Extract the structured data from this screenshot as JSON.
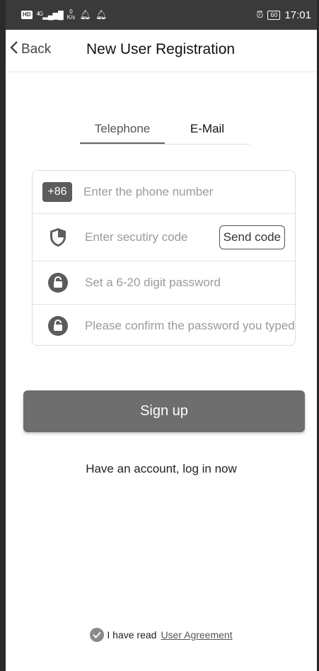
{
  "status_bar": {
    "hd_badge": "HD",
    "network": "4G",
    "speed_value": "0",
    "speed_unit": "K/s",
    "battery": "60",
    "time": "17:01"
  },
  "header": {
    "back_label": "Back",
    "title": "New User Registration"
  },
  "tabs": [
    {
      "label": "Telephone",
      "active": true
    },
    {
      "label": "E-Mail",
      "active": false
    }
  ],
  "form": {
    "country_code": "+86",
    "phone_placeholder": "Enter the phone number",
    "security_placeholder": "Enter secutiry code",
    "send_code_label": "Send code",
    "password_placeholder": "Set a 6-20 digit password",
    "confirm_placeholder": "Please confirm the password you typed"
  },
  "actions": {
    "signup_label": "Sign up",
    "login_link": "Have an account, log in now"
  },
  "agreement": {
    "prefix": "I have read",
    "link_label": "User Agreement"
  },
  "colors": {
    "status_bar_bg": "#3a3a3a",
    "button_bg": "#6e6e6e",
    "prefix_bg": "#5c5c5c"
  }
}
